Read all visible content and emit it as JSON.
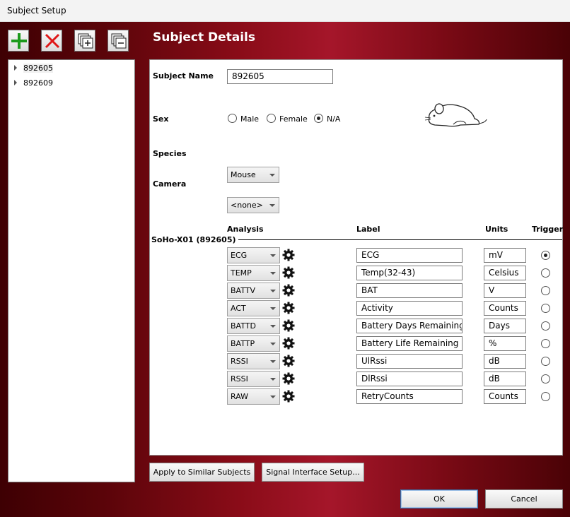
{
  "window": {
    "title": "Subject Setup"
  },
  "toolbar": {
    "add_icon": "plus-icon",
    "delete_icon": "red-x-icon",
    "expand_icon": "expand-all-icon",
    "collapse_icon": "collapse-all-icon"
  },
  "tree": {
    "items": [
      {
        "label": "892605"
      },
      {
        "label": "892609"
      }
    ]
  },
  "details": {
    "title": "Subject Details",
    "subject_name_label": "Subject Name",
    "subject_name_value": "892605",
    "sex_label": "Sex",
    "sex_options": [
      "Male",
      "Female",
      "N/A"
    ],
    "sex_selected": "N/A",
    "species_label": "Species",
    "species_value": "Mouse",
    "camera_label": "Camera",
    "camera_value": "<none>",
    "device_label": "SoHo-X01 (892605)",
    "columns": {
      "analysis": "Analysis",
      "label": "Label",
      "units": "Units",
      "trigger": "Trigger"
    },
    "rows": [
      {
        "analysis": "ECG",
        "label": "ECG",
        "units": "mV",
        "trigger": true
      },
      {
        "analysis": "TEMP",
        "label": "Temp(32-43)",
        "units": "Celsius",
        "trigger": false
      },
      {
        "analysis": "BATTV",
        "label": "BAT",
        "units": "V",
        "trigger": false
      },
      {
        "analysis": "ACT",
        "label": "Activity",
        "units": "Counts",
        "trigger": false
      },
      {
        "analysis": "BATTD",
        "label": "Battery Days Remaining",
        "units": "Days",
        "trigger": false
      },
      {
        "analysis": "BATTP",
        "label": "Battery Life Remaining",
        "units": "%",
        "trigger": false
      },
      {
        "analysis": "RSSI",
        "label": "UlRssi",
        "units": "dB",
        "trigger": false
      },
      {
        "analysis": "RSSI",
        "label": "DlRssi",
        "units": "dB",
        "trigger": false
      },
      {
        "analysis": "RAW",
        "label": "RetryCounts",
        "units": "Counts",
        "trigger": false
      }
    ]
  },
  "buttons": {
    "apply_similar": "Apply to Similar Subjects",
    "signal_setup": "Signal Interface Setup...",
    "ok": "OK",
    "cancel": "Cancel"
  }
}
